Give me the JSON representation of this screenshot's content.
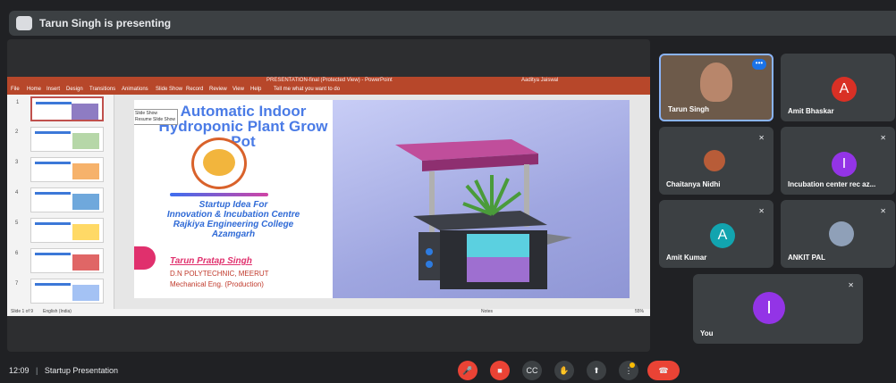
{
  "presenter_banner": {
    "text": "Tarun Singh is presenting",
    "icon": "presentation-icon"
  },
  "powerpoint": {
    "title": "PRESENTATION-final (Protected View) - PowerPoint",
    "user": "Aaditya Jaiswal",
    "ribbon": [
      "File",
      "Home",
      "Insert",
      "Design",
      "Transitions",
      "Animations",
      "Slide Show",
      "Record",
      "Review",
      "View",
      "Help",
      "Tell me what you want to do"
    ],
    "status": {
      "slide": "Slide 1 of 9",
      "language": "English (India)",
      "notes": "Notes",
      "zoom": "55%"
    },
    "thumbs": [
      "1",
      "2",
      "3",
      "4",
      "5",
      "6",
      "7"
    ],
    "context_menu": [
      "Slide Show",
      "Resume Slide Show"
    ]
  },
  "slide": {
    "title": "Automatic Indoor Hydroponic Plant Grow Pot",
    "subtitle_1": "Startup Idea For",
    "subtitle_2": "Innovation & Incubation Centre",
    "subtitle_3": "Rajkiya Engineering College",
    "subtitle_4": "Azamgarh",
    "presenter_name": "Tarun Pratap Singh",
    "institute": "D.N POLYTECHNIC, MEERUT",
    "department": "Mechanical Eng. (Production)"
  },
  "participants": [
    {
      "name": "Tarun Singh",
      "type": "video"
    },
    {
      "name": "Amit Bhaskar",
      "initial": "A",
      "color": "#d93025"
    },
    {
      "name": "Chaitanya Nidhi",
      "type": "photo"
    },
    {
      "name": "Incubation center rec az...",
      "initial": "I",
      "color": "#9334e6"
    },
    {
      "name": "Amit Kumar",
      "initial": "A",
      "color": "#12a4af"
    },
    {
      "name": "ANKIT PAL",
      "type": "photo"
    },
    {
      "name": "You",
      "initial": "I",
      "color": "#9334e6"
    }
  ],
  "bottom": {
    "time": "12:09",
    "separator": "|",
    "meeting": "Startup Presentation",
    "controls": [
      "mic-off-icon",
      "camera-off-icon",
      "captions-icon",
      "raise-hand-icon",
      "present-icon",
      "more-icon",
      "hang-up-icon"
    ]
  }
}
